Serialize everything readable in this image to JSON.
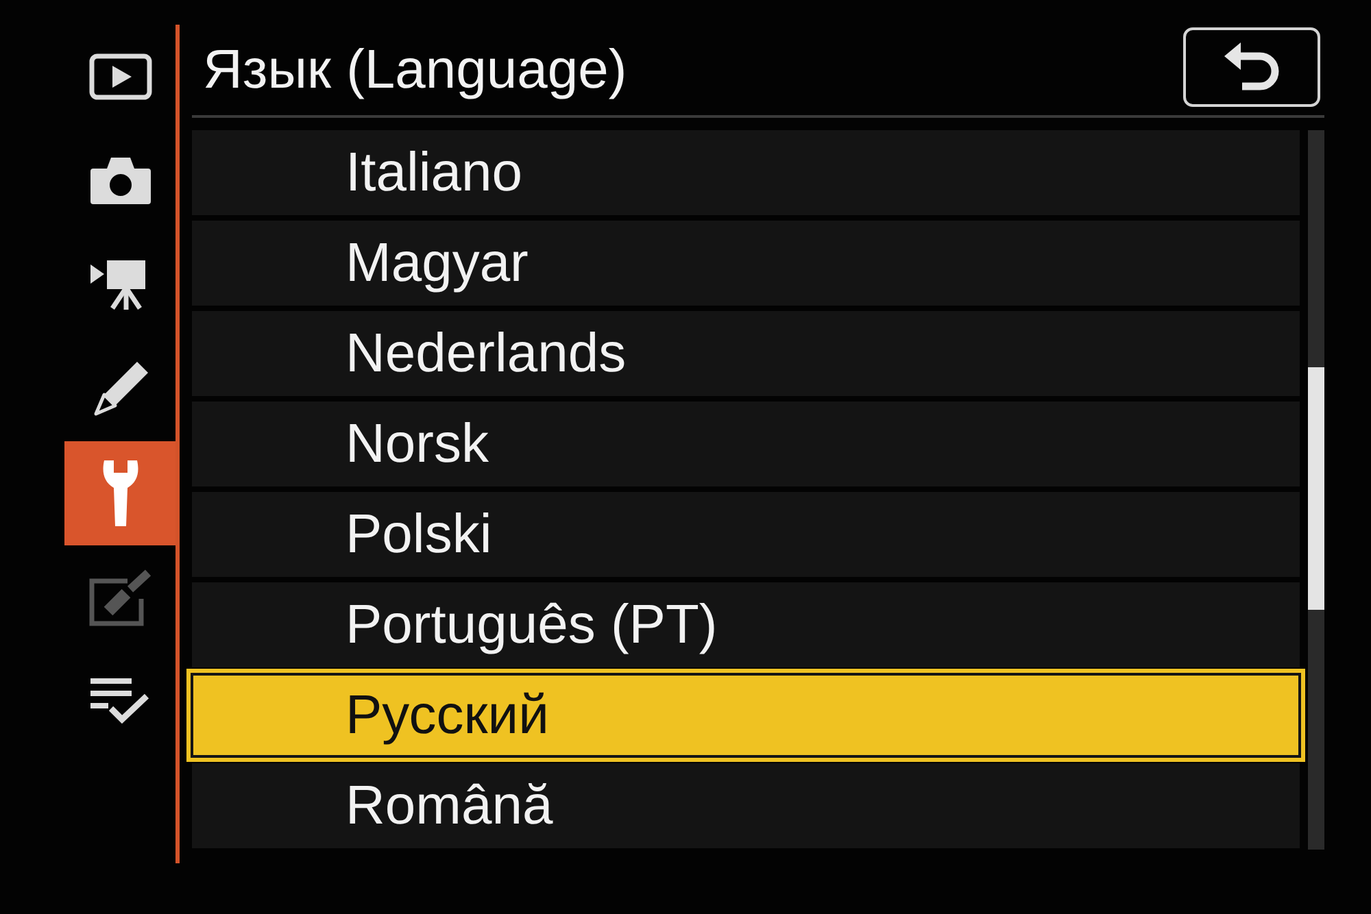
{
  "sidebar": {
    "items": [
      {
        "kind": "playback",
        "selected": false,
        "disabled": false
      },
      {
        "kind": "photo",
        "selected": false,
        "disabled": false
      },
      {
        "kind": "movie",
        "selected": false,
        "disabled": false
      },
      {
        "kind": "custom",
        "selected": false,
        "disabled": false
      },
      {
        "kind": "setup",
        "selected": true,
        "disabled": false
      },
      {
        "kind": "retouch",
        "selected": false,
        "disabled": true
      },
      {
        "kind": "mymenu",
        "selected": false,
        "disabled": false
      }
    ]
  },
  "title": "Язык (Language)",
  "languages": [
    {
      "label": "Italiano",
      "selected": false
    },
    {
      "label": "Magyar",
      "selected": false
    },
    {
      "label": "Nederlands",
      "selected": false
    },
    {
      "label": "Norsk",
      "selected": false
    },
    {
      "label": "Polski",
      "selected": false
    },
    {
      "label": "Português (PT)",
      "selected": false
    },
    {
      "label": "Русский",
      "selected": true
    },
    {
      "label": "Română",
      "selected": false
    }
  ]
}
